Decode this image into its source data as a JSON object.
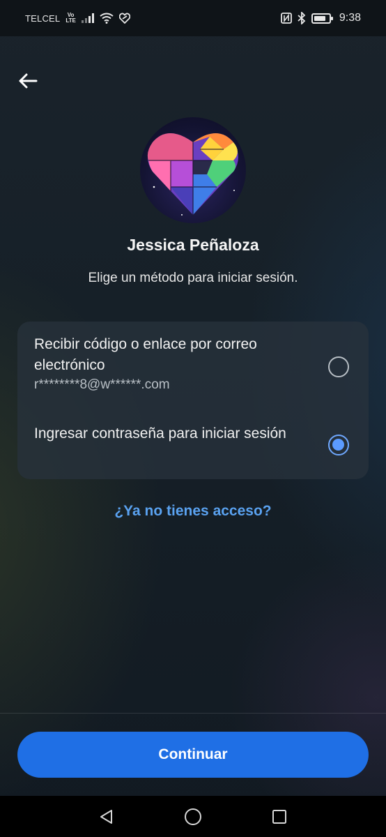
{
  "status_bar": {
    "carrier": "TELCEL",
    "volte_top": "Vo",
    "volte_bottom": "LTE",
    "time": "9:38",
    "icons": [
      "signal-icon",
      "wifi-icon",
      "data-saver-icon",
      "nfc-icon",
      "bluetooth-icon",
      "battery-icon"
    ]
  },
  "header": {
    "back_icon": "arrow-left-icon"
  },
  "profile": {
    "avatar_description_icon": "puzzle-heart-avatar",
    "name": "Jessica Peñaloza",
    "subtitle": "Elige un método para iniciar sesión."
  },
  "options": [
    {
      "title": "Recibir código o enlace por correo electrónico",
      "detail": "r********8@w******.com",
      "selected": false
    },
    {
      "title": "Ingresar contraseña para iniciar sesión",
      "selected": true
    }
  ],
  "help_link": "¿Ya no tienes acceso?",
  "continue_label": "Continuar",
  "colors": {
    "accent": "#1f6fe5",
    "link": "#5aa2f0",
    "card": "#28323c",
    "radio_selected": "#5b9bff"
  },
  "nav_bar": {
    "icons": [
      "back-triangle-icon",
      "home-circle-icon",
      "recents-square-icon"
    ]
  }
}
